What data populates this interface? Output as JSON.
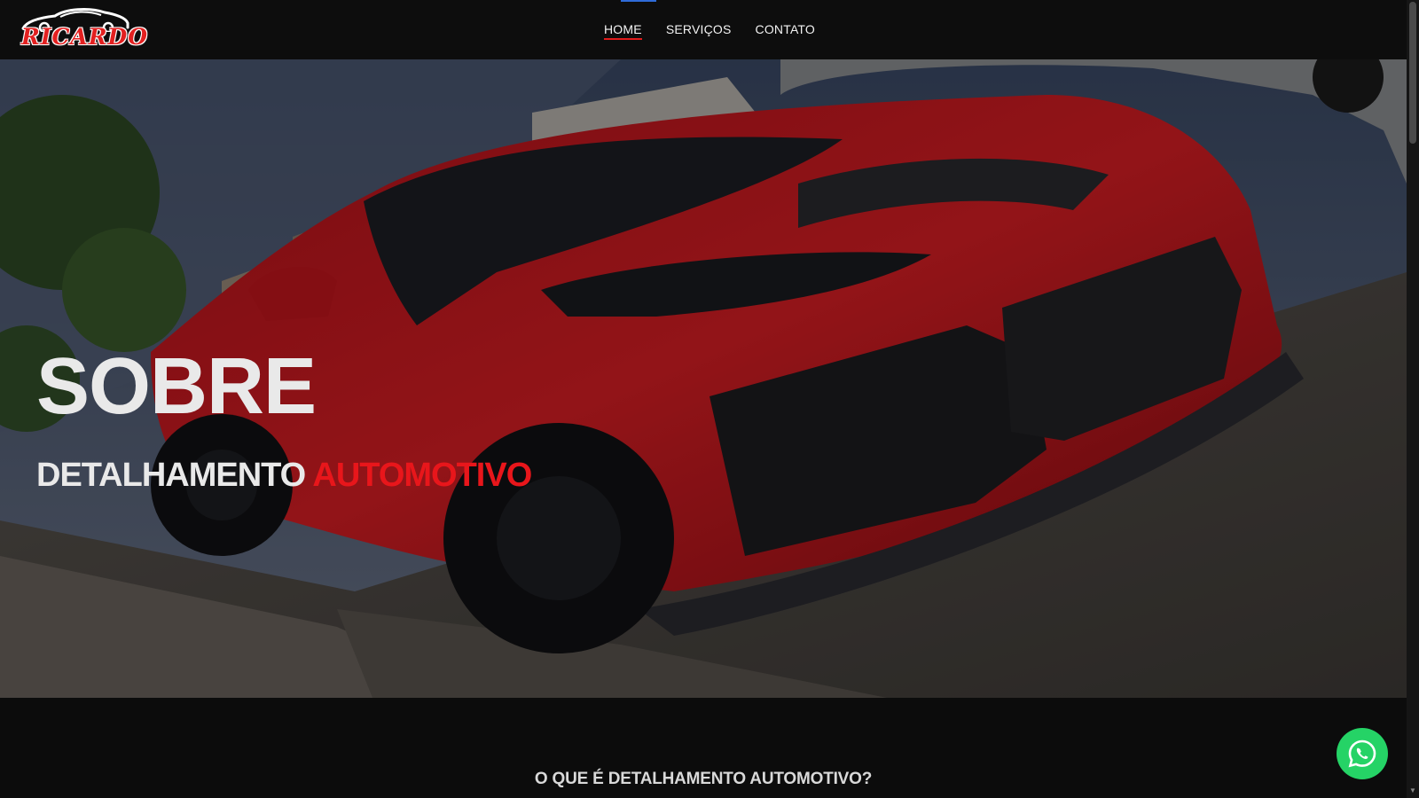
{
  "brand": {
    "logo_text": "RICARDO"
  },
  "nav": {
    "items": [
      {
        "label": "HOME",
        "active": true
      },
      {
        "label": "SERVIÇOS",
        "active": false
      },
      {
        "label": "CONTATO",
        "active": false
      }
    ]
  },
  "hero": {
    "title": "SOBRE",
    "subtitle_main": "DETALHAMENTO",
    "subtitle_accent": "AUTOMOTIVO",
    "image_subject": "red sports car"
  },
  "section": {
    "heading": "O QUE É DETALHAMENTO AUTOMOTIVO?"
  },
  "whatsapp": {
    "icon": "whatsapp-icon"
  },
  "colors": {
    "accent_red": "#e8161b",
    "background": "#0c0c0c",
    "whatsapp_green": "#25d366",
    "text_light": "#e9e9e9"
  }
}
